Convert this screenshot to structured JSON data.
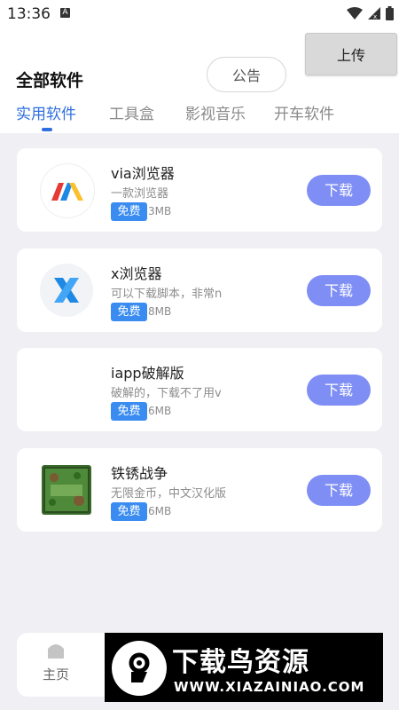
{
  "status_bar": {
    "time": "13:36",
    "a_icon": "A"
  },
  "header": {
    "upload_label": "上传",
    "notice_label": "公告",
    "title": "全部软件"
  },
  "tabs": [
    {
      "label": "实用软件",
      "active": true
    },
    {
      "label": "工具盒",
      "active": false
    },
    {
      "label": "影视音乐",
      "active": false
    },
    {
      "label": "开车软件",
      "active": false
    }
  ],
  "apps": [
    {
      "name": "via浏览器",
      "desc": "一款浏览器",
      "badge": "免费",
      "size": "3MB",
      "button": "下载",
      "icon": "via-logo-icon"
    },
    {
      "name": "x浏览器",
      "desc": "可以下载脚本，非常n",
      "badge": "免费",
      "size": "8MB",
      "button": "下载",
      "icon": "x-browser-logo-icon"
    },
    {
      "name": "iapp破解版",
      "desc": "破解的，下载不了用v",
      "badge": "免费",
      "size": "6MB",
      "button": "下载",
      "icon": "blank-icon"
    },
    {
      "name": "铁锈战争",
      "desc": "无限金币，中文汉化版",
      "badge": "免费",
      "size": "6MB",
      "button": "下载",
      "icon": "rusted-warfare-icon"
    }
  ],
  "bottom_nav": {
    "home_label": "主页"
  },
  "watermark": {
    "title": "下载鸟资源",
    "url": "WWW.XIAZAINIAO.COM"
  },
  "colors": {
    "accent": "#2f6fe0",
    "download_button": "#7f8ef5",
    "badge": "#3a8cf0",
    "background": "#efeff4"
  }
}
